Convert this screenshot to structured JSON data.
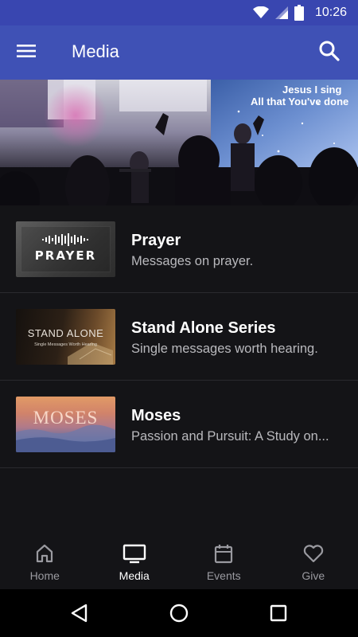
{
  "status_bar": {
    "time": "10:26"
  },
  "app_bar": {
    "title": "Media"
  },
  "hero": {
    "screen_text_line1": "Jesus I sing",
    "screen_text_line2": "All that You've done"
  },
  "media_items": [
    {
      "title": "Prayer",
      "subtitle": "Messages on prayer.",
      "thumb_label": "PRAYER"
    },
    {
      "title": "Stand Alone Series",
      "subtitle": "Single messages worth hearing.",
      "thumb_label": "STAND ALONE",
      "thumb_sublabel": "Single Messages Worth Hearing"
    },
    {
      "title": "Moses",
      "subtitle": "Passion and Pursuit: A Study on...",
      "thumb_label": "MOSES"
    }
  ],
  "bottom_nav": {
    "active": "Media",
    "items": [
      {
        "label": "Home",
        "icon": "home-icon"
      },
      {
        "label": "Media",
        "icon": "tv-icon"
      },
      {
        "label": "Events",
        "icon": "calendar-icon"
      },
      {
        "label": "Give",
        "icon": "heart-icon"
      }
    ]
  },
  "colors": {
    "app_bar": "#3f51b5",
    "status_bar": "#3946b0",
    "background": "#141417"
  }
}
